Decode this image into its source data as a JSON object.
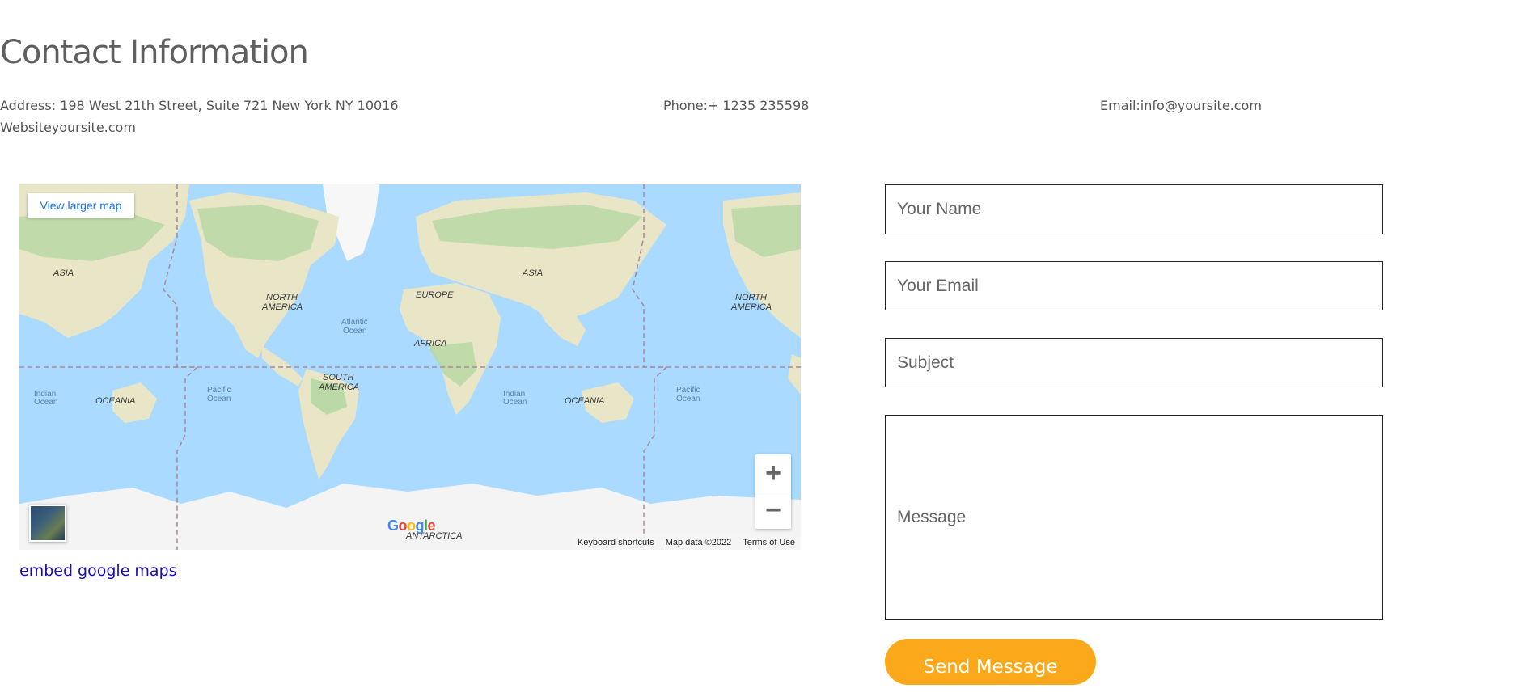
{
  "contact": {
    "title": "Contact Information",
    "address": "Address: 198 West 21th Street, Suite 721 New York NY 10016",
    "website": "Websiteyoursite.com",
    "phone": "Phone:+ 1235 235598",
    "email": "Email:info@yoursite.com"
  },
  "map": {
    "view_larger_label": "View larger map",
    "zoom_in_label": "+",
    "zoom_out_label": "−",
    "google_logo": "Google",
    "footer": {
      "keyboard_shortcuts": "Keyboard shortcuts",
      "map_data": "Map data ©2022",
      "terms": "Terms of Use"
    },
    "labels": {
      "asia": "ASIA",
      "north_america": "NORTH",
      "north_america_2": "AMERICA",
      "europe": "EUROPE",
      "africa": "AFRICA",
      "south_america": "SOUTH",
      "south_america_2": "AMERICA",
      "oceania": "OCEANIA",
      "atlantic": "Atlantic",
      "atlantic_2": "Ocean",
      "pacific": "Pacific",
      "pacific_2": "Ocean",
      "indian": "Indian",
      "indian_2": "Ocean",
      "antarctica": "ANTARCTICA"
    },
    "colors": {
      "water": "#aadaff",
      "land": "#e8e6c7",
      "forest": "#b6d7a3",
      "ice": "#f4f4f4"
    }
  },
  "embed_link": "embed google maps",
  "form": {
    "name_placeholder": "Your Name",
    "email_placeholder": "Your Email",
    "subject_placeholder": "Subject",
    "message_placeholder": "Message",
    "send_label": "Send Message",
    "send_color": "#fba91a"
  }
}
